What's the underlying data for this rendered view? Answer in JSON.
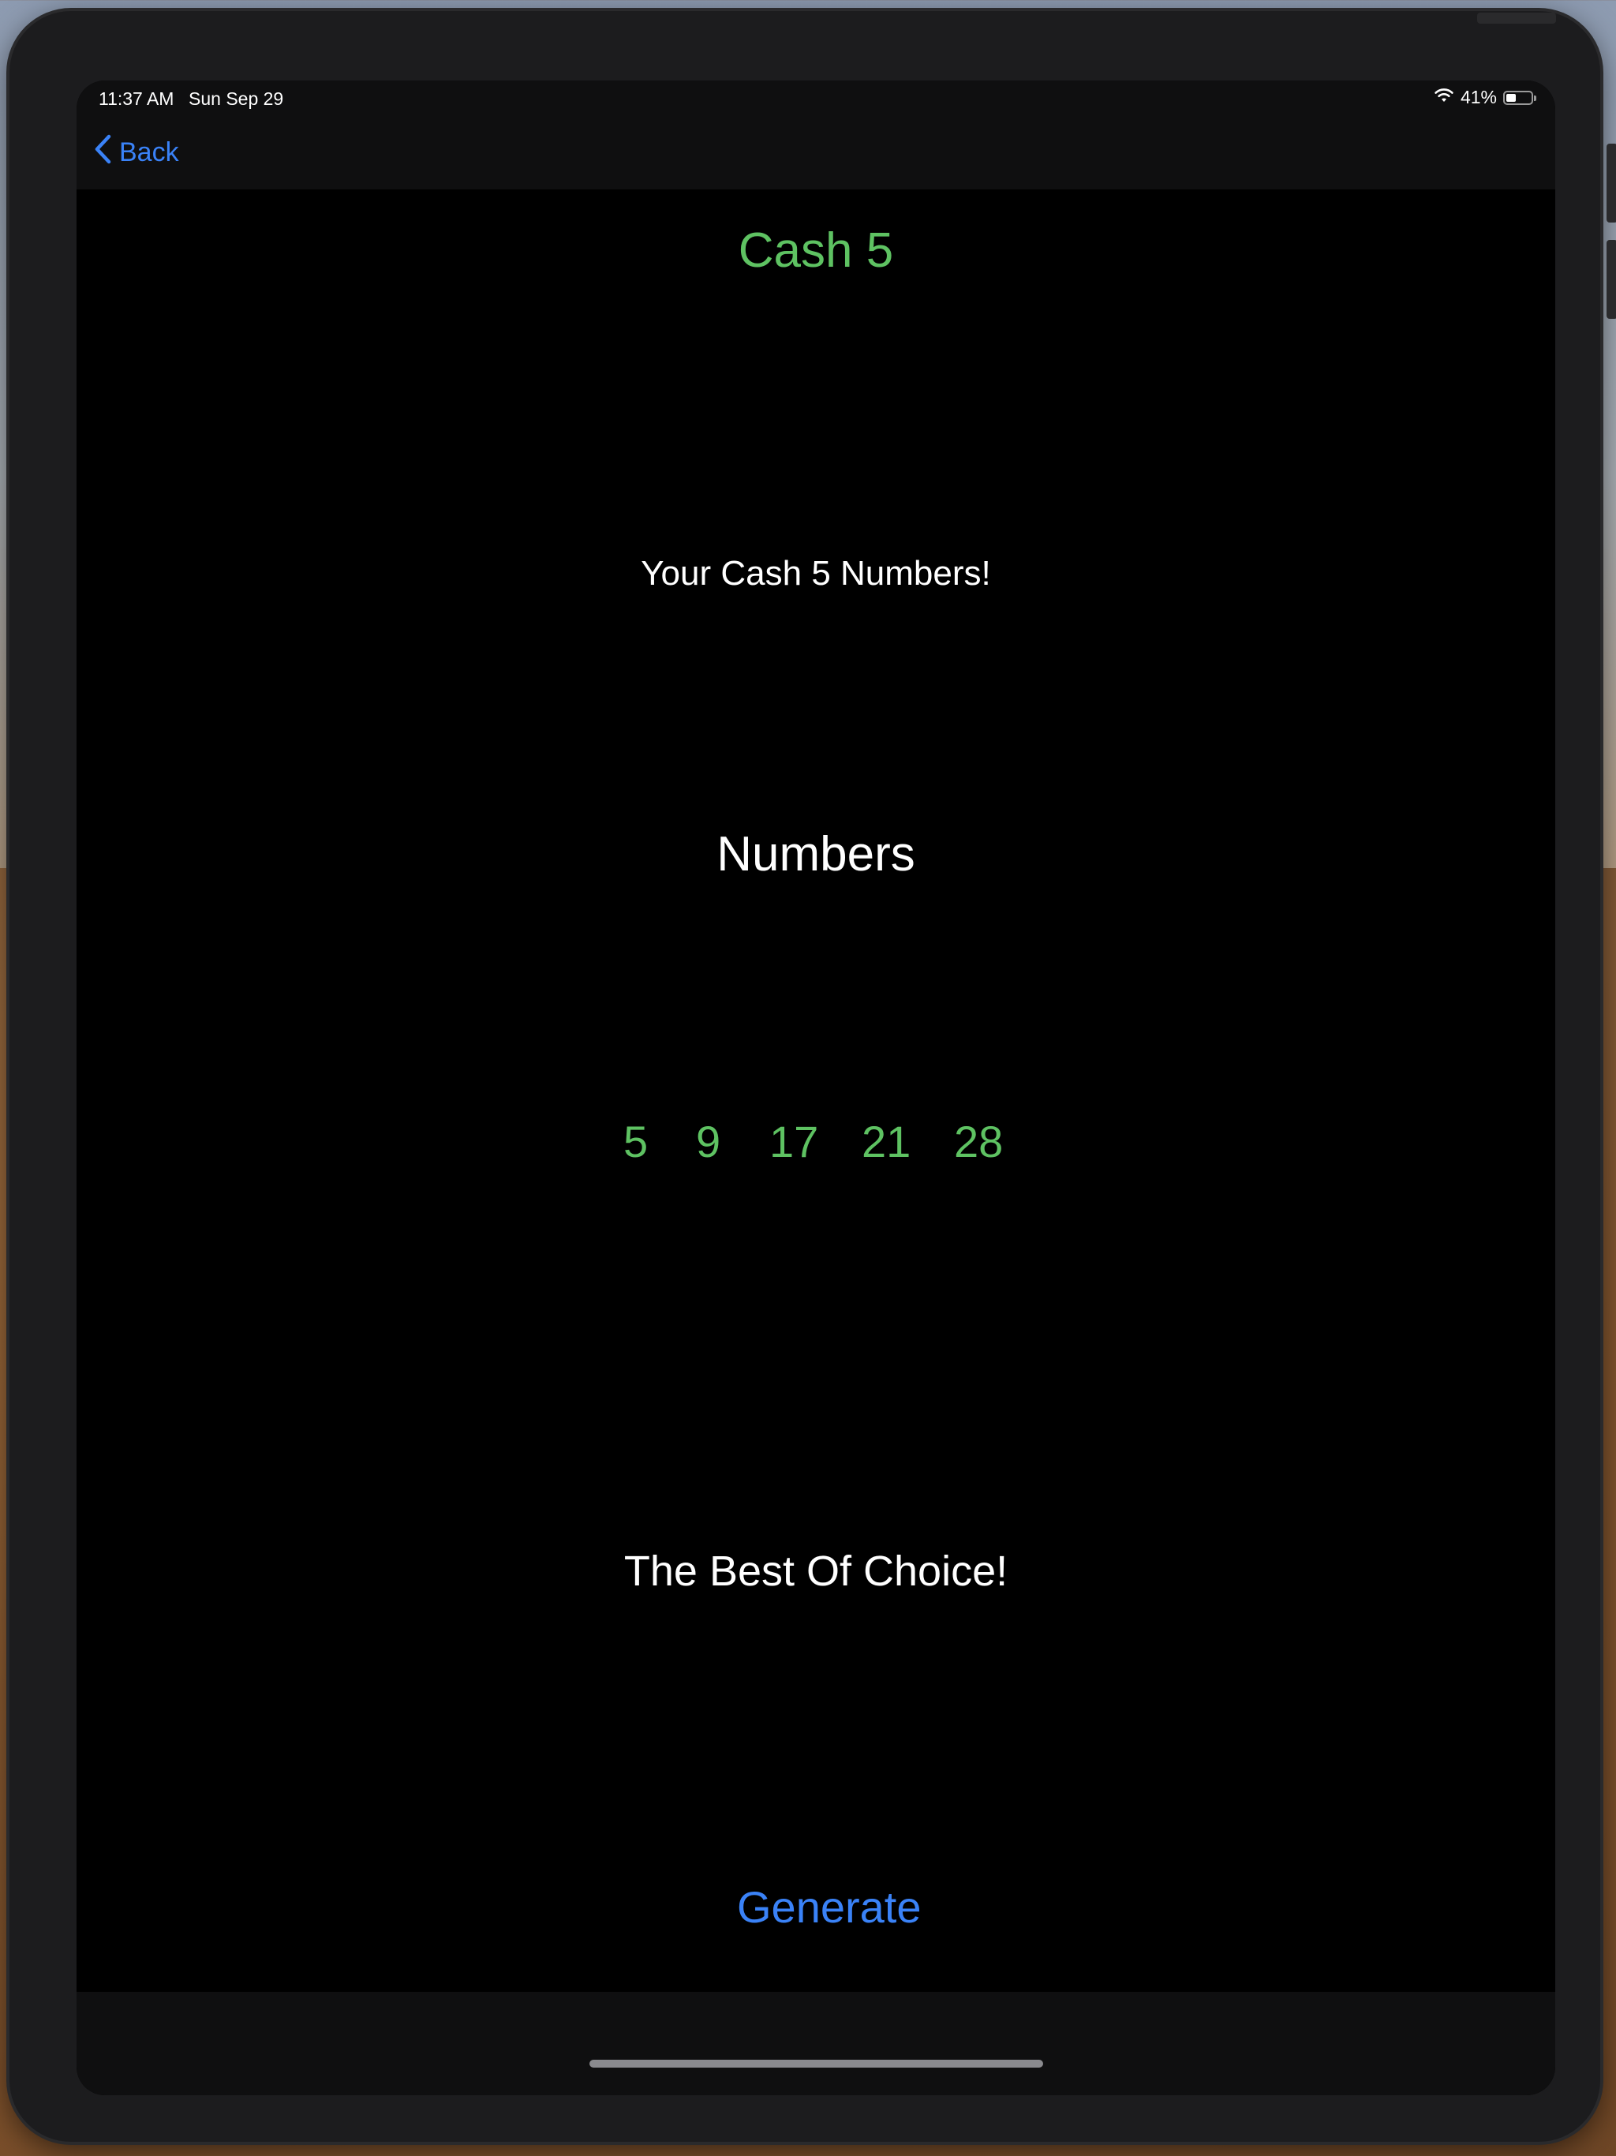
{
  "status_bar": {
    "time": "11:37 AM",
    "date": "Sun Sep 29",
    "battery_text": "41%",
    "battery_level": 0.41
  },
  "nav": {
    "back_label": "Back"
  },
  "content": {
    "title": "Cash 5",
    "subtitle": "Your Cash 5 Numbers!",
    "numbers_heading": "Numbers",
    "numbers": [
      "5",
      "9",
      "17",
      "21",
      "28"
    ],
    "tagline": "The Best Of Choice!",
    "generate_label": "Generate"
  },
  "colors": {
    "accent_green": "#5ec262",
    "link_blue": "#3a82f7",
    "background": "#000000",
    "bar_background": "#0f0f10"
  },
  "icons": {
    "back": "chevron-left-icon",
    "wifi": "wifi-icon",
    "battery": "battery-icon"
  }
}
